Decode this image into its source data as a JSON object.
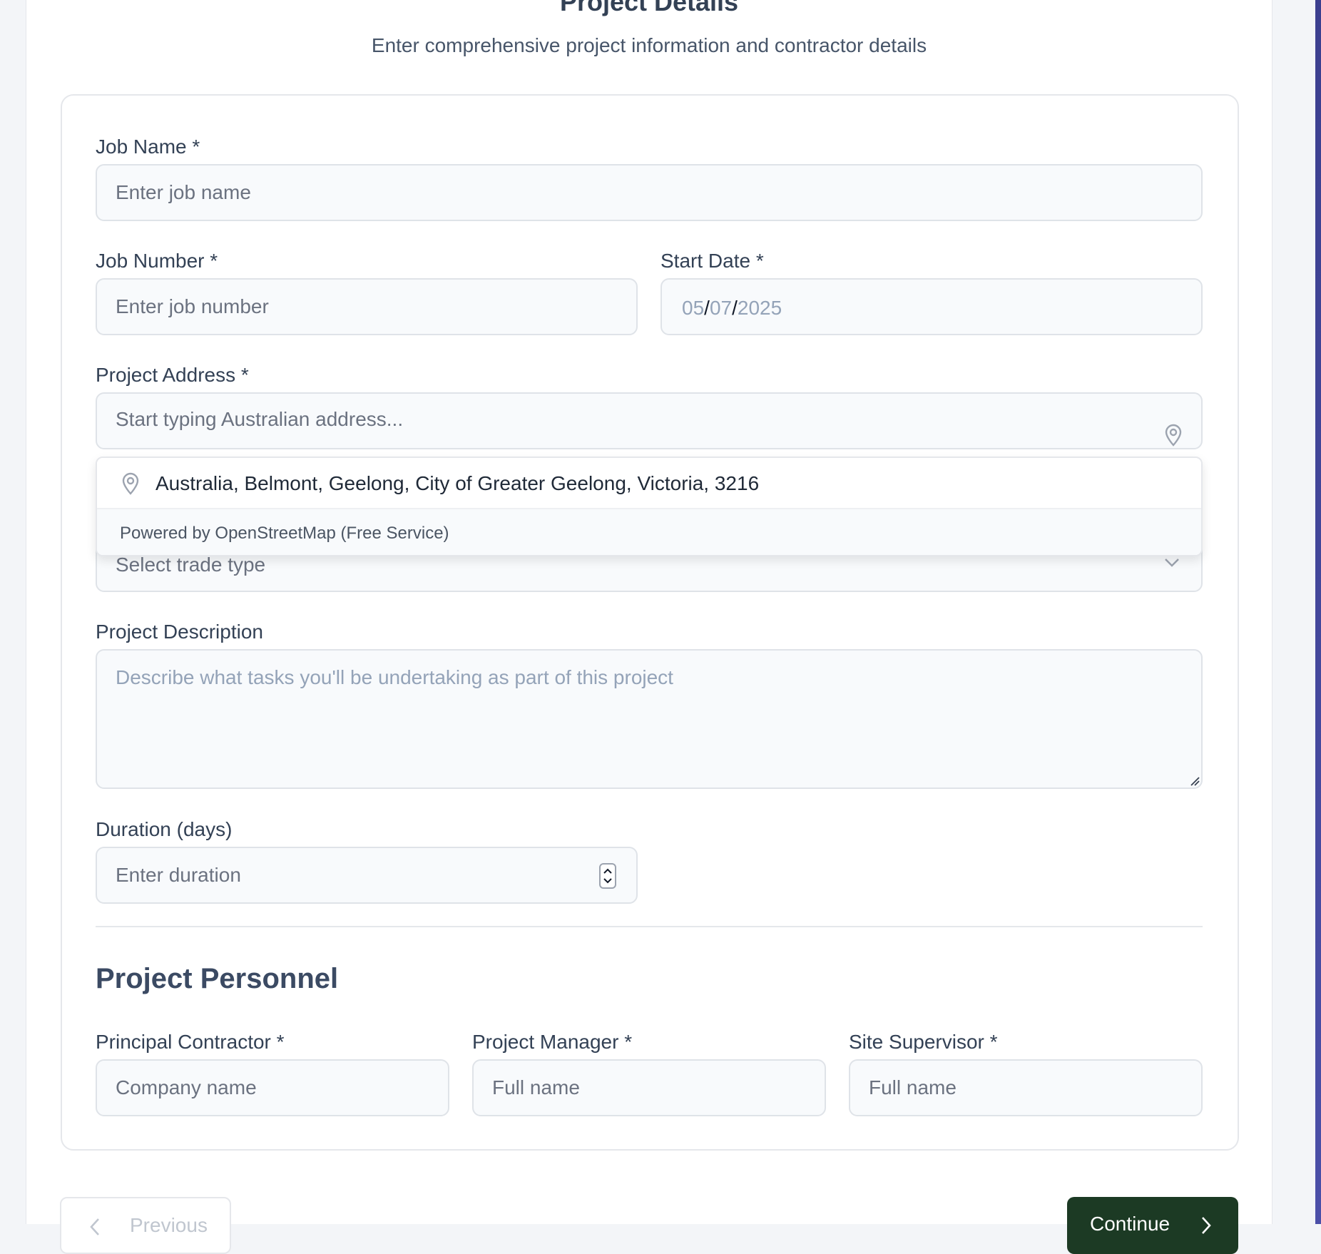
{
  "header": {
    "title": "Project Details",
    "subtitle": "Enter comprehensive project information and contractor details"
  },
  "form": {
    "job_name": {
      "label": "Job Name *",
      "placeholder": "Enter job name"
    },
    "job_number": {
      "label": "Job Number *",
      "placeholder": "Enter job number"
    },
    "start_date": {
      "label": "Start Date *",
      "day": "05",
      "month": "07",
      "year": "2025",
      "separator": "/"
    },
    "project_address": {
      "label": "Project Address *",
      "placeholder": "Start typing Australian address..."
    },
    "trade_type": {
      "placeholder": "Select trade type"
    },
    "project_description": {
      "label": "Project Description",
      "placeholder": "Describe what tasks you'll be undertaking as part of this project"
    },
    "duration": {
      "label": "Duration (days)",
      "placeholder": "Enter duration"
    }
  },
  "address_suggestions": {
    "items": [
      "Australia, Belmont, Geelong, City of Greater Geelong, Victoria, 3216"
    ],
    "footer": "Powered by OpenStreetMap (Free Service)"
  },
  "personnel": {
    "title": "Project Personnel",
    "principal_contractor": {
      "label": "Principal Contractor *",
      "placeholder": "Company name"
    },
    "project_manager": {
      "label": "Project Manager *",
      "placeholder": "Full name"
    },
    "site_supervisor": {
      "label": "Site Supervisor *",
      "placeholder": "Full name"
    }
  },
  "nav": {
    "previous_label": "Previous",
    "continue_label": "Continue"
  },
  "colors": {
    "primary_button": "#1c3a24",
    "input_background": "#f8fafc",
    "text": "#334155"
  }
}
